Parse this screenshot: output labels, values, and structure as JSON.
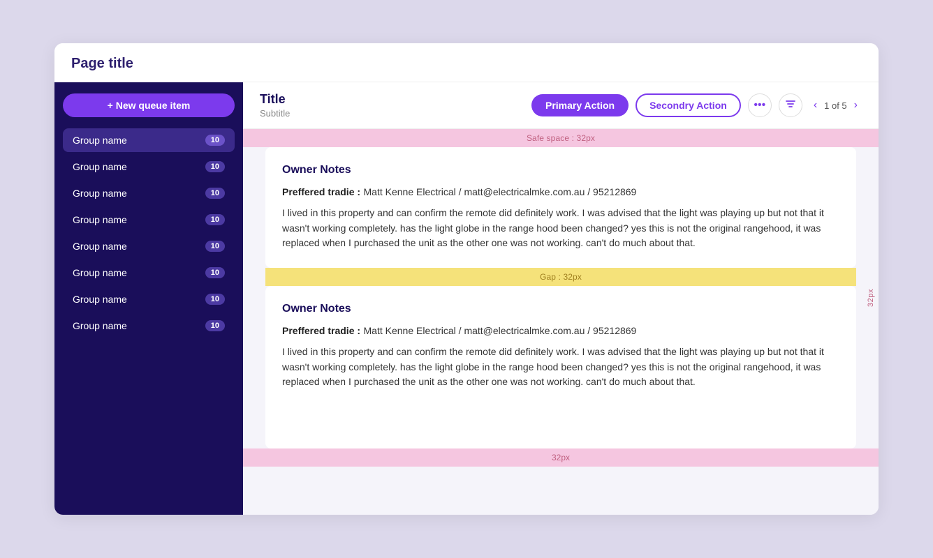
{
  "page": {
    "title": "Page title"
  },
  "header": {
    "title": "Title",
    "subtitle": "Subtitle",
    "primaryAction": "Primary Action",
    "secondaryAction": "Secondry Action",
    "pagination": {
      "current": "1 of 5"
    }
  },
  "sidebar": {
    "newButtonLabel": "+ New queue item",
    "items": [
      {
        "label": "Group name",
        "badge": "10",
        "active": true
      },
      {
        "label": "Group name",
        "badge": "10",
        "active": false
      },
      {
        "label": "Group name",
        "badge": "10",
        "active": false
      },
      {
        "label": "Group name",
        "badge": "10",
        "active": false
      },
      {
        "label": "Group name",
        "badge": "10",
        "active": false
      },
      {
        "label": "Group name",
        "badge": "10",
        "active": false
      },
      {
        "label": "Group name",
        "badge": "10",
        "active": false
      },
      {
        "label": "Group name",
        "badge": "10",
        "active": false
      }
    ]
  },
  "content": {
    "safespaceLabel": "Safe space : 32px",
    "gapLabel": "Gap : 32px",
    "bottomLabel": "32px",
    "rightLabel": "32px",
    "cards": [
      {
        "title": "Owner Notes",
        "fieldLabel": "Preffered tradie :",
        "fieldValue": " Matt Kenne Electrical / matt@electricalmke.com.au / 95212869",
        "bodyText": "I lived in this property and can confirm the remote did definitely work. I was advised that the light was playing up but not that it wasn't working completely. has the light globe in the range hood been changed? yes this is not the original rangehood, it was replaced when I purchased the unit as the other one was not working. can't do much about that."
      },
      {
        "title": "Owner Notes",
        "fieldLabel": "Preffered tradie :",
        "fieldValue": " Matt Kenne Electrical / matt@electricalmke.com.au / 95212869",
        "bodyText": "I lived in this property and can confirm the remote did definitely work. I was advised that the light was playing up but not that it wasn't working completely. has the light globe in the range hood been changed? yes this is not the original rangehood, it was replaced when I purchased the unit as the other one was not working. can't do much about that."
      }
    ]
  }
}
